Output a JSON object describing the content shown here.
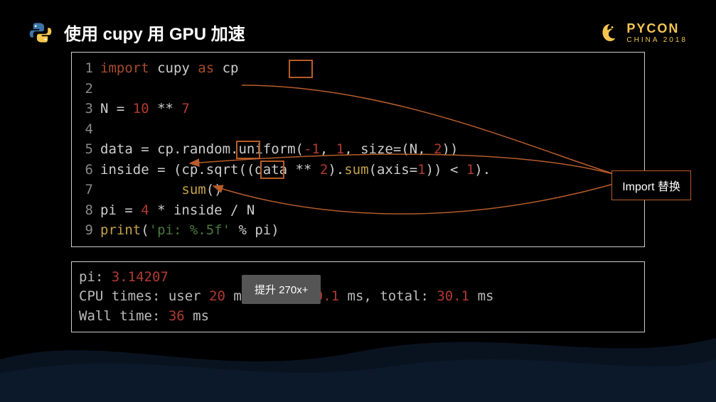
{
  "header": {
    "title": "使用 cupy 用 GPU 加速",
    "brand_main": "PYCON",
    "brand_sub": "CHINA 2018"
  },
  "code": {
    "l1_import": "import",
    "l1_mod": " cupy ",
    "l1_as": "as",
    "l1_alias": " cp",
    "l3_a": "N = ",
    "l3_n1": "10",
    "l3_b": " ** ",
    "l3_n2": "7",
    "l5_a": "data = cp.random.uniform(",
    "l5_n1": "-1",
    "l5_b": ", ",
    "l5_n2": "1",
    "l5_c": ", size=(N, ",
    "l5_n3": "2",
    "l5_d": "))",
    "l6_a": "inside = (cp.sqrt((data ** ",
    "l6_n1": "2",
    "l6_b": ").",
    "l6_sum": "sum",
    "l6_c": "(axis=",
    "l6_n2": "1",
    "l6_d": ")) < ",
    "l6_n3": "1",
    "l6_e": ").",
    "l7_pad": "          ",
    "l7_sum": "sum",
    "l7_a": "()",
    "l8_a": "pi = ",
    "l8_n1": "4",
    "l8_b": " * inside / N",
    "l9_a": "print",
    "l9_b": "(",
    "l9_str": "'pi: %.5f'",
    "l9_c": " % pi)",
    "ln1": "1",
    "ln2": "2",
    "ln3": "3",
    "ln4": "4",
    "ln5": "5",
    "ln6": "6",
    "ln7": "7",
    "ln8": "8",
    "ln9": "9"
  },
  "annotation": {
    "label": "Import 替换"
  },
  "output": {
    "l1_a": "pi: ",
    "l1_v": "3.14207",
    "l2_a": "CPU times: user ",
    "l2_v1": "20",
    "l2_b": " ms, sys: ",
    "l2_v2": "10.1",
    "l2_c": " ms, total: ",
    "l2_v3": "30.1",
    "l2_d": " ms",
    "l3_a": "Wall time: ",
    "l3_v": "36",
    "l3_b": " ms"
  },
  "callout": {
    "speedup": "提升 270x+"
  }
}
